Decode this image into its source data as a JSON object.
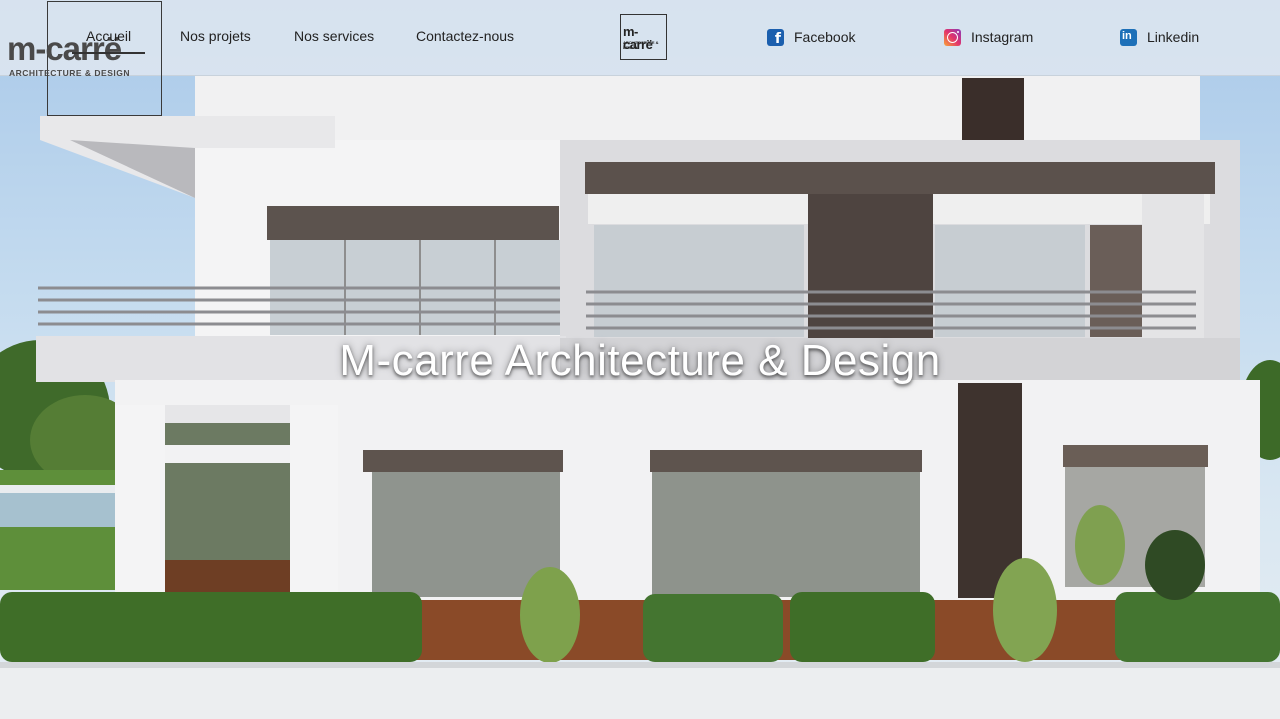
{
  "logo": {
    "wordmark": "m-carrë",
    "tagline": "ARCHITECTURE & DESIGN"
  },
  "nav": {
    "items": [
      {
        "label": "Accueil",
        "active": true
      },
      {
        "label": "Nos projets",
        "active": false
      },
      {
        "label": "Nos services",
        "active": false
      },
      {
        "label": "Contactez-nous",
        "active": false
      }
    ]
  },
  "center_logo": {
    "wordmark": "m-carrë",
    "tagline": "ARCHITECTURE & DESIGN"
  },
  "social": {
    "facebook": {
      "label": "Facebook",
      "icon": "facebook-icon"
    },
    "instagram": {
      "label": "Instagram",
      "icon": "instagram-icon"
    },
    "linkedin": {
      "label": "Linkedin",
      "icon": "linkedin-icon"
    }
  },
  "hero": {
    "title": "M-carre Architecture & Design"
  },
  "colors": {
    "facebook": "#1b5fae",
    "linkedin": "#1d70b8",
    "text": "#222222"
  }
}
